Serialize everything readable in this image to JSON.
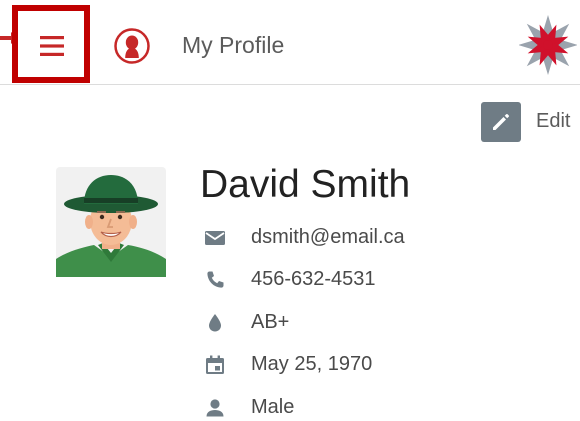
{
  "header": {
    "title": "My Profile",
    "menu_icon": "hamburger-menu-icon",
    "profile_icon": "user-silhouette-icon",
    "logo": "red-star-flower-logo",
    "highlight_color": "#c00000",
    "accent_color": "#c62828"
  },
  "actions": {
    "edit_label": "Edit",
    "edit_icon": "pencil-icon"
  },
  "profile": {
    "name": "David Smith",
    "avatar": "cartoon-man-green-hat-avatar",
    "email": "dsmith@email.ca",
    "phone": "456-632-4531",
    "blood_type": "AB+",
    "birth_date": "May 25, 1970",
    "gender": "Male"
  },
  "icons": {
    "email": "mail-icon",
    "phone": "phone-icon",
    "blood_type": "blood-drop-icon",
    "birth_date": "calendar-icon",
    "gender": "person-icon",
    "icon_color": "#6f7c85"
  }
}
